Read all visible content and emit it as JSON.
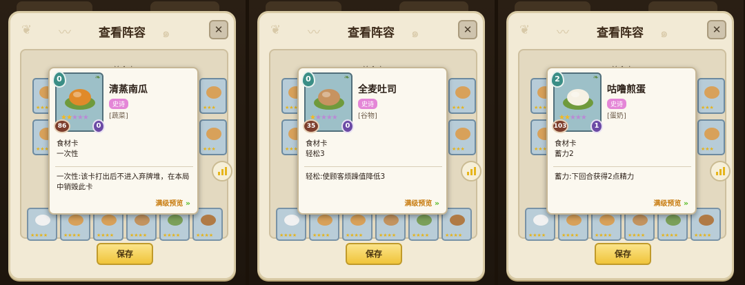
{
  "panels": [
    {
      "title": "查看阵容",
      "section_label": "美食卡",
      "card": {
        "name": "清蒸南瓜",
        "rarity": "史诗",
        "category": "[蔬菜]",
        "cost": "0",
        "attack": "86",
        "health": "0",
        "stars_filled": 2,
        "stars_total": 5,
        "food_color": "#e08a2a"
      },
      "card_type": "食材卡",
      "keyword": "一次性",
      "effect": "一次性:该卡打出后不进入弃牌堆，在本局中销毁此卡",
      "preview_label": "满级预览",
      "save_label": "保存"
    },
    {
      "title": "查看阵容",
      "section_label": "美食卡",
      "card": {
        "name": "全麦吐司",
        "rarity": "史诗",
        "category": "[谷物]",
        "cost": "0",
        "attack": "35",
        "health": "0",
        "stars_filled": 1,
        "stars_total": 5,
        "food_color": "#c79360"
      },
      "card_type": "食材卡",
      "keyword": "轻松3",
      "effect": "轻松:使顾客烦躁值降低3",
      "preview_label": "满级预览",
      "save_label": "保存"
    },
    {
      "title": "查看阵容",
      "section_label": "美食卡",
      "card": {
        "name": "咕噜煎蛋",
        "rarity": "史诗",
        "category": "[蛋奶]",
        "cost": "2",
        "attack": "103",
        "health": "1",
        "stars_filled": 2,
        "stars_total": 5,
        "food_color": "#f6f1e4"
      },
      "card_type": "食材卡",
      "keyword": "蓄力2",
      "effect": "蓄力:下回合获得2点精力",
      "preview_label": "满级预览",
      "save_label": "保存"
    }
  ],
  "colors": {
    "dialog_bg": "#f2ead5",
    "save_button": "#f0c43a",
    "rarity_badge": "#e486d7",
    "preview_text": "#c87c10"
  }
}
